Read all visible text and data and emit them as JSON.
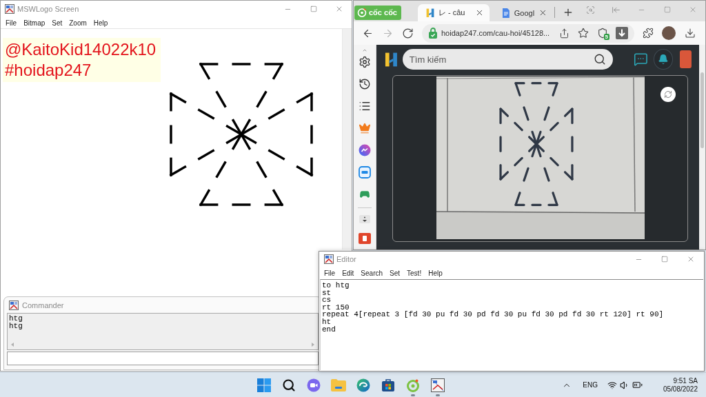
{
  "logo_window": {
    "title": "MSWLogo Screen",
    "menu": [
      "File",
      "Bitmap",
      "Set",
      "Zoom",
      "Help"
    ],
    "canvas_text": [
      "@KaitoKid14022k10",
      "#hoidap247"
    ]
  },
  "commander": {
    "title": "Commander",
    "output": [
      "htg",
      "htg"
    ]
  },
  "browser": {
    "brand": "cốc cốc",
    "tabs": [
      {
        "label": "レ - câu",
        "selected": true
      },
      {
        "label": "Googl",
        "selected": false
      }
    ],
    "nav_buttons": [
      {
        "kind": "back",
        "disabled": false
      },
      {
        "kind": "forward",
        "disabled": true
      },
      {
        "kind": "reload",
        "disabled": false
      }
    ],
    "url": "hoidap247.com/cau-hoi/45128...",
    "extension_badge": "5",
    "search": {
      "placeholder": "Tìm kiếm"
    }
  },
  "editor": {
    "title": "Editor",
    "menu": [
      "File",
      "Edit",
      "Search",
      "Set",
      "Test!",
      "Help"
    ],
    "lines": [
      "to htg",
      "st",
      "cs",
      "rt 150",
      "repeat 4[repeat 3 [fd 30 pu fd 30 pd fd 30 pu fd 30 pd fd 30 rt 120] rt 90]",
      "ht",
      "end"
    ]
  },
  "taskbar": {
    "apps": [
      {
        "kind": "start",
        "running": false
      },
      {
        "kind": "search",
        "running": false
      },
      {
        "kind": "chat",
        "running": false
      },
      {
        "kind": "files",
        "running": false
      },
      {
        "kind": "edge",
        "running": false
      },
      {
        "kind": "store",
        "running": false
      },
      {
        "kind": "coccoc",
        "running": true
      },
      {
        "kind": "logo",
        "running": true
      }
    ],
    "language": "ENG",
    "time": "9:51 SA",
    "date": "05/08/2022"
  }
}
